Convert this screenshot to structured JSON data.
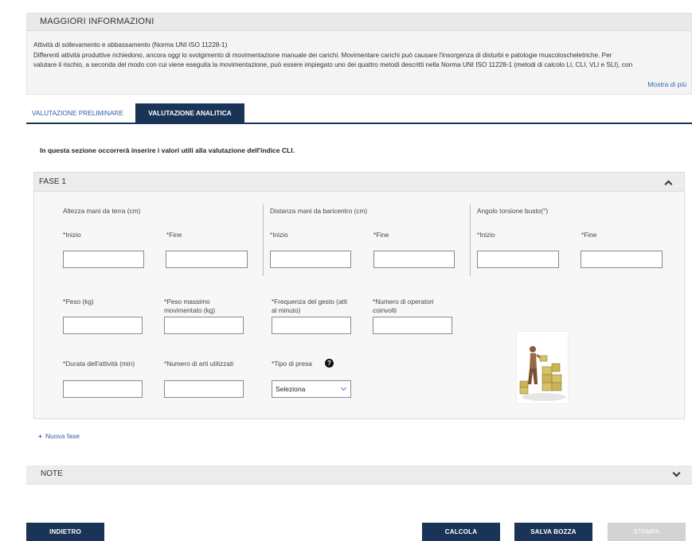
{
  "info": {
    "header": "MAGGIORI INFORMAZIONI",
    "lines": [
      "Attività di sollevamento e abbassamento (Norma UNI ISO 11228-1)",
      "Differenti attività produttive richiedono, ancora oggi lo svolgimento di movimentazione manuale dei carichi. Movimentare carichi può causare l'insorgenza di disturbi e patologie muscoloscheletriche. Per",
      "valutare il rischio, a seconda del modo con cui viene eseguita la movimentazione, può essere impiegato uno dei quattro metodi descritti nella Norma UNI ISO 11228-1 (metodi di calcolo LI, CLI, VLI e SLI), con"
    ],
    "more_link": "Mostra di più"
  },
  "tabs": [
    {
      "label": "VALUTAZIONE PRELIMINARE",
      "active": false
    },
    {
      "label": "VALUTAZIONE ANALITICA",
      "active": true
    }
  ],
  "intro": "In questa sezione occorrerà inserire i valori utili alla valutazione dell'indice CLI.",
  "fase": {
    "title": "FASE 1",
    "groups": [
      {
        "label": "Altezza mani da terra (cm)",
        "start": "*Inizio",
        "end": "*Fine"
      },
      {
        "label": "Distanza mani da baricentro (cm)",
        "start": "*Inizio",
        "end": "*Fine"
      },
      {
        "label": "Angolo torsione busto(°)",
        "start": "*Inizio",
        "end": "*Fine"
      }
    ],
    "row2": [
      {
        "label": "*Peso (kg)"
      },
      {
        "label": "*Peso massimo movimentato (kg)"
      },
      {
        "label": "*Frequenza del gesto (atti al minuto)"
      },
      {
        "label": "*Numero di operatori coinvolti"
      }
    ],
    "row3": [
      {
        "label": "*Durata dell'attività (min)"
      },
      {
        "label": "*Numero di arti utilizzati"
      },
      {
        "label": "*Tipo di presa"
      }
    ],
    "select_value": "Seleziona",
    "help_icon": "?"
  },
  "nuova_fase": "Nuova fase",
  "note": {
    "title": "NOTE"
  },
  "buttons": {
    "back": "INDIETRO",
    "calc": "CALCOLA",
    "save": "SALVA BOZZA",
    "print": "STAMPA"
  },
  "colors": {
    "navy": "#1a3457",
    "link": "#2f5fa0",
    "disabled": "#d3d3d3"
  }
}
